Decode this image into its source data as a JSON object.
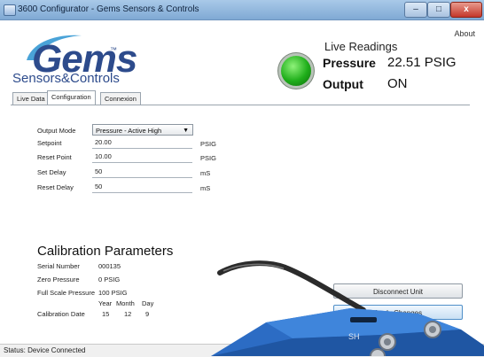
{
  "window": {
    "title": "3600 Configurator - Gems Sensors & Controls",
    "minimize_glyph": "–",
    "maximize_glyph": "□",
    "close_glyph": "x"
  },
  "header": {
    "about_label": "About",
    "logo_text": "Gems",
    "logo_tm": "™",
    "logo_subtitle": "Sensors&Controls"
  },
  "live_readings": {
    "title": "Live Readings",
    "pressure_label": "Pressure",
    "pressure_value": "22.51 PSIG",
    "output_label": "Output",
    "output_value": "ON",
    "indicator_color": "#1fae1a"
  },
  "tabs": [
    {
      "label": "Live Data"
    },
    {
      "label": "Configuration"
    },
    {
      "label": "Connexion"
    }
  ],
  "config": {
    "output_mode_label": "Output Mode",
    "output_mode_value": "Pressure - Active High",
    "setpoint_label": "Setpoint",
    "setpoint_value": "20.00",
    "setpoint_unit": "PSIG",
    "reset_point_label": "Reset Point",
    "reset_point_value": "10.00",
    "reset_point_unit": "PSIG",
    "set_delay_label": "Set Delay",
    "set_delay_value": "50",
    "set_delay_unit": "mS",
    "reset_delay_label": "Reset Delay",
    "reset_delay_value": "50",
    "reset_delay_unit": "mS"
  },
  "calibration": {
    "title": "Calibration Parameters",
    "serial_label": "Serial Number",
    "serial_value": "000135",
    "zero_label": "Zero Pressure",
    "zero_value": "0 PSIG",
    "full_scale_label": "Full Scale Pressure",
    "full_scale_value": "100 PSIG",
    "date_label": "Calibration Date",
    "year_head": "Year",
    "month_head": "Month",
    "day_head": "Day",
    "year_value": "15",
    "month_value": "12",
    "day_value": "9"
  },
  "buttons": {
    "disconnect_label": "Disconnect Unit",
    "apply_label": "Apply Changes"
  },
  "status": {
    "text": "Status:  Device Connected"
  },
  "device": {
    "marking": "SH",
    "body_color": "#2c6cc4"
  }
}
